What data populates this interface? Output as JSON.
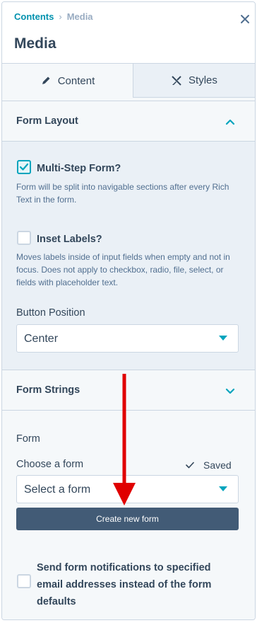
{
  "breadcrumb": {
    "parent": "Contents",
    "separator": "›",
    "current": "Media"
  },
  "panel": {
    "title": "Media"
  },
  "tabs": [
    {
      "label": "Content",
      "icon": "pencil-icon",
      "active": true
    },
    {
      "label": "Styles",
      "icon": "styles-icon",
      "active": false
    }
  ],
  "form_layout": {
    "heading": "Form Layout",
    "expanded": true,
    "multi_step": {
      "label": "Multi-Step Form?",
      "checked": true,
      "help": "Form will be split into navigable sections after every Rich Text in the form."
    },
    "inset_labels": {
      "label": "Inset Labels?",
      "checked": false,
      "help": "Moves labels inside of input fields when empty and not in focus. Does not apply to checkbox, radio, file, select, or fields with placeholder text."
    },
    "button_position": {
      "label": "Button Position",
      "value": "Center"
    }
  },
  "form_strings": {
    "heading": "Form Strings",
    "expanded": false
  },
  "form": {
    "section_label": "Form",
    "choose_label": "Choose a form",
    "saved_label": "Saved",
    "select_placeholder": "Select a form",
    "create_button": "Create new form",
    "notify_label": "Send form notifications to specified email addresses instead of the form defaults",
    "notify_checked": false
  },
  "colors": {
    "accent": "#00a4bd",
    "button": "#425b76",
    "arrow": "#e00000",
    "link": "#0091ae"
  }
}
